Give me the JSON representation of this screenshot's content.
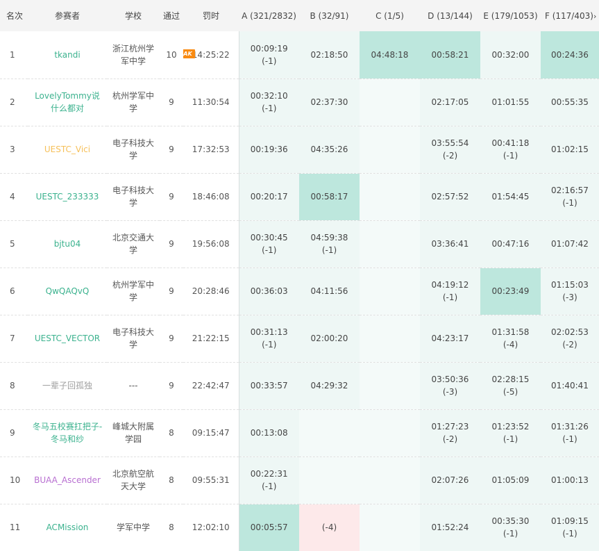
{
  "header": {
    "rank": "名次",
    "user": "参赛者",
    "school": "学校",
    "solved": "通过",
    "penalty": "罚时",
    "problems": [
      "A (321/2832)",
      "B (32/91)",
      "C (1/5)",
      "D (13/144)",
      "E (179/1053)",
      "F (117/403)"
    ],
    "more_glyph": "›"
  },
  "colors": {
    "accepted_bg": "#eef7f5",
    "first_blood_bg": "#bde7dd",
    "failed_bg": "#fde9ea",
    "user_green": "#3bb28e",
    "user_gold": "#f6c05a",
    "user_gray": "#a0a0a0",
    "user_purple": "#b86fd1",
    "ak_badge": "#f98b12"
  },
  "rows": [
    {
      "rank": "1",
      "user": "tkandi",
      "color": "green",
      "school": "浙江杭州学军中学",
      "solved": "10",
      "badge": "AK",
      "penalty": "14:25:22",
      "cells": [
        {
          "t": "00:09:19",
          "w": "(-1)",
          "s": "ac"
        },
        {
          "t": "02:18:50",
          "w": "",
          "s": "ac"
        },
        {
          "t": "04:48:18",
          "w": "",
          "s": "first"
        },
        {
          "t": "00:58:21",
          "w": "",
          "s": "first"
        },
        {
          "t": "00:32:00",
          "w": "",
          "s": "ac"
        },
        {
          "t": "00:24:36",
          "w": "",
          "s": "first"
        }
      ]
    },
    {
      "rank": "2",
      "user": "LovelyTommy说什么都对",
      "color": "green",
      "school": "杭州学军中学",
      "solved": "9",
      "badge": "",
      "penalty": "11:30:54",
      "cells": [
        {
          "t": "00:32:10",
          "w": "(-1)",
          "s": "ac"
        },
        {
          "t": "02:37:30",
          "w": "",
          "s": "ac"
        },
        {
          "t": "",
          "w": "",
          "s": "empty"
        },
        {
          "t": "02:17:05",
          "w": "",
          "s": "ac"
        },
        {
          "t": "01:01:55",
          "w": "",
          "s": "ac"
        },
        {
          "t": "00:55:35",
          "w": "",
          "s": "ac"
        }
      ]
    },
    {
      "rank": "3",
      "user": "UESTC_Vici",
      "color": "gold",
      "school": "电子科技大学",
      "solved": "9",
      "badge": "",
      "penalty": "17:32:53",
      "cells": [
        {
          "t": "00:19:36",
          "w": "",
          "s": "ac"
        },
        {
          "t": "04:35:26",
          "w": "",
          "s": "ac"
        },
        {
          "t": "",
          "w": "",
          "s": "empty"
        },
        {
          "t": "03:55:54",
          "w": "(-2)",
          "s": "ac"
        },
        {
          "t": "00:41:18",
          "w": "(-1)",
          "s": "ac"
        },
        {
          "t": "01:02:15",
          "w": "",
          "s": "ac"
        }
      ]
    },
    {
      "rank": "4",
      "user": "UESTC_233333",
      "color": "green",
      "school": "电子科技大学",
      "solved": "9",
      "badge": "",
      "penalty": "18:46:08",
      "cells": [
        {
          "t": "00:20:17",
          "w": "",
          "s": "ac"
        },
        {
          "t": "00:58:17",
          "w": "",
          "s": "first"
        },
        {
          "t": "",
          "w": "",
          "s": "empty"
        },
        {
          "t": "02:57:52",
          "w": "",
          "s": "ac"
        },
        {
          "t": "01:54:45",
          "w": "",
          "s": "ac"
        },
        {
          "t": "02:16:57",
          "w": "(-1)",
          "s": "ac"
        }
      ]
    },
    {
      "rank": "5",
      "user": "bjtu04",
      "color": "green",
      "school": "北京交通大学",
      "solved": "9",
      "badge": "",
      "penalty": "19:56:08",
      "cells": [
        {
          "t": "00:30:45",
          "w": "(-1)",
          "s": "ac"
        },
        {
          "t": "04:59:38",
          "w": "(-1)",
          "s": "ac"
        },
        {
          "t": "",
          "w": "",
          "s": "empty"
        },
        {
          "t": "03:36:41",
          "w": "",
          "s": "ac"
        },
        {
          "t": "00:47:16",
          "w": "",
          "s": "ac"
        },
        {
          "t": "01:07:42",
          "w": "",
          "s": "ac"
        }
      ]
    },
    {
      "rank": "6",
      "user": "QwQAQvQ",
      "color": "green",
      "school": "杭州学军中学",
      "solved": "9",
      "badge": "",
      "penalty": "20:28:46",
      "cells": [
        {
          "t": "00:36:03",
          "w": "",
          "s": "ac"
        },
        {
          "t": "04:11:56",
          "w": "",
          "s": "ac"
        },
        {
          "t": "",
          "w": "",
          "s": "empty"
        },
        {
          "t": "04:19:12",
          "w": "(-1)",
          "s": "ac"
        },
        {
          "t": "00:23:49",
          "w": "",
          "s": "first"
        },
        {
          "t": "01:15:03",
          "w": "(-3)",
          "s": "ac"
        }
      ]
    },
    {
      "rank": "7",
      "user": "UESTC_VECTOR",
      "color": "green",
      "school": "电子科技大学",
      "solved": "9",
      "badge": "",
      "penalty": "21:22:15",
      "cells": [
        {
          "t": "00:31:13",
          "w": "(-1)",
          "s": "ac"
        },
        {
          "t": "02:00:20",
          "w": "",
          "s": "ac"
        },
        {
          "t": "",
          "w": "",
          "s": "empty"
        },
        {
          "t": "04:23:17",
          "w": "",
          "s": "ac"
        },
        {
          "t": "01:31:58",
          "w": "(-4)",
          "s": "ac"
        },
        {
          "t": "02:02:53",
          "w": "(-2)",
          "s": "ac"
        }
      ]
    },
    {
      "rank": "8",
      "user": "一辈子回孤独",
      "color": "gray",
      "school": "---",
      "solved": "9",
      "badge": "",
      "penalty": "22:42:47",
      "cells": [
        {
          "t": "00:33:57",
          "w": "",
          "s": "ac"
        },
        {
          "t": "04:29:32",
          "w": "",
          "s": "ac"
        },
        {
          "t": "",
          "w": "",
          "s": "empty"
        },
        {
          "t": "03:50:36",
          "w": "(-3)",
          "s": "ac"
        },
        {
          "t": "02:28:15",
          "w": "(-5)",
          "s": "ac"
        },
        {
          "t": "01:40:41",
          "w": "",
          "s": "ac"
        }
      ]
    },
    {
      "rank": "9",
      "user": "冬马五校赛扛把子-冬马和纱",
      "color": "green",
      "school": "峰城大附属学园",
      "solved": "8",
      "badge": "",
      "penalty": "09:15:47",
      "cells": [
        {
          "t": "00:13:08",
          "w": "",
          "s": "ac"
        },
        {
          "t": "",
          "w": "",
          "s": "empty"
        },
        {
          "t": "",
          "w": "",
          "s": "empty"
        },
        {
          "t": "01:27:23",
          "w": "(-2)",
          "s": "ac"
        },
        {
          "t": "01:23:52",
          "w": "(-1)",
          "s": "ac"
        },
        {
          "t": "01:31:26",
          "w": "(-1)",
          "s": "ac"
        }
      ]
    },
    {
      "rank": "10",
      "user": "BUAA_Ascender",
      "color": "purple",
      "school": "北京航空航天大学",
      "solved": "8",
      "badge": "",
      "penalty": "09:55:31",
      "cells": [
        {
          "t": "00:22:31",
          "w": "(-1)",
          "s": "ac"
        },
        {
          "t": "",
          "w": "",
          "s": "empty"
        },
        {
          "t": "",
          "w": "",
          "s": "empty"
        },
        {
          "t": "02:07:26",
          "w": "",
          "s": "ac"
        },
        {
          "t": "01:05:09",
          "w": "",
          "s": "ac"
        },
        {
          "t": "01:00:13",
          "w": "",
          "s": "ac"
        }
      ]
    },
    {
      "rank": "11",
      "user": "ACMission",
      "color": "green",
      "school": "学军中学",
      "solved": "8",
      "badge": "",
      "penalty": "12:02:10",
      "cells": [
        {
          "t": "00:05:57",
          "w": "",
          "s": "first"
        },
        {
          "t": "",
          "w": "(-4)",
          "s": "fail"
        },
        {
          "t": "",
          "w": "",
          "s": "empty"
        },
        {
          "t": "01:52:24",
          "w": "",
          "s": "ac"
        },
        {
          "t": "00:35:30",
          "w": "(-1)",
          "s": "ac"
        },
        {
          "t": "01:09:15",
          "w": "(-1)",
          "s": "ac"
        }
      ]
    }
  ]
}
